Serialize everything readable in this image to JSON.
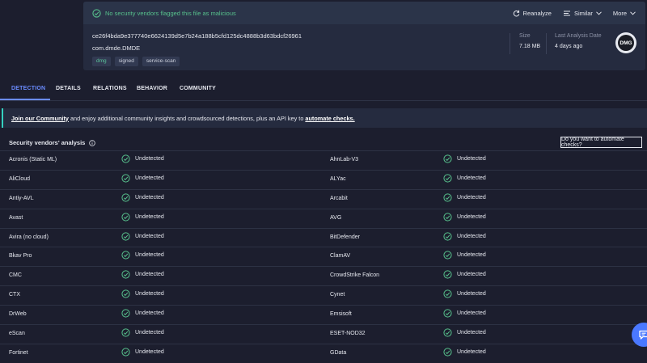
{
  "banner": {
    "message": "No security vendors flagged this file as malicious",
    "reanalyze": "Reanalyze",
    "similar": "Similar",
    "more": "More"
  },
  "file": {
    "hash": "ce26f4bda9e377740e6624139d5e7b24a188b5cfd125dc4888b3d63bdcf26961",
    "name": "com.dmde.DMDE",
    "tags": [
      "dmg",
      "signed",
      "service-scan"
    ],
    "size_label": "Size",
    "size_value": "7.18 MB",
    "last_analysis_label": "Last Analysis Date",
    "last_analysis_value": "4 days ago",
    "type_badge": "DMG"
  },
  "tabs": [
    "DETECTION",
    "DETAILS",
    "RELATIONS",
    "BEHAVIOR",
    "COMMUNITY"
  ],
  "community": {
    "join_link": "Join our Community",
    "middle_text": " and enjoy additional community insights and crowdsourced detections, plus an API key to ",
    "automate_link": "automate checks."
  },
  "analysis": {
    "title": "Security vendors' analysis",
    "automate_button": "Do you want to automate checks?"
  },
  "vendors": [
    {
      "left": "Acronis (Static ML)",
      "left_status": "Undetected",
      "right": "AhnLab-V3",
      "right_status": "Undetected"
    },
    {
      "left": "AliCloud",
      "left_status": "Undetected",
      "right": "ALYac",
      "right_status": "Undetected"
    },
    {
      "left": "Antiy-AVL",
      "left_status": "Undetected",
      "right": "Arcabit",
      "right_status": "Undetected"
    },
    {
      "left": "Avast",
      "left_status": "Undetected",
      "right": "AVG",
      "right_status": "Undetected"
    },
    {
      "left": "Avira (no cloud)",
      "left_status": "Undetected",
      "right": "BitDefender",
      "right_status": "Undetected"
    },
    {
      "left": "Bkav Pro",
      "left_status": "Undetected",
      "right": "ClamAV",
      "right_status": "Undetected"
    },
    {
      "left": "CMC",
      "left_status": "Undetected",
      "right": "CrowdStrike Falcon",
      "right_status": "Undetected"
    },
    {
      "left": "CTX",
      "left_status": "Undetected",
      "right": "Cynet",
      "right_status": "Undetected"
    },
    {
      "left": "DrWeb",
      "left_status": "Undetected",
      "right": "Emsisoft",
      "right_status": "Undetected"
    },
    {
      "left": "eScan",
      "left_status": "Undetected",
      "right": "ESET-NOD32",
      "right_status": "Undetected"
    },
    {
      "left": "Fortinet",
      "left_status": "Undetected",
      "right": "GData",
      "right_status": "Undetected"
    }
  ],
  "colors": {
    "background": "#1c1e2e",
    "card": "#252b3f",
    "accent": "#6b8cff",
    "clean": "#57c08c",
    "community_border": "#35d0c0"
  },
  "icons": {
    "banner": "check-circle-icon",
    "reanalyze": "refresh-icon",
    "similar": "similar-icon",
    "more": "chevron-down-icon",
    "status": "check-circle-icon",
    "info": "info-icon",
    "chat": "chat-icon"
  }
}
